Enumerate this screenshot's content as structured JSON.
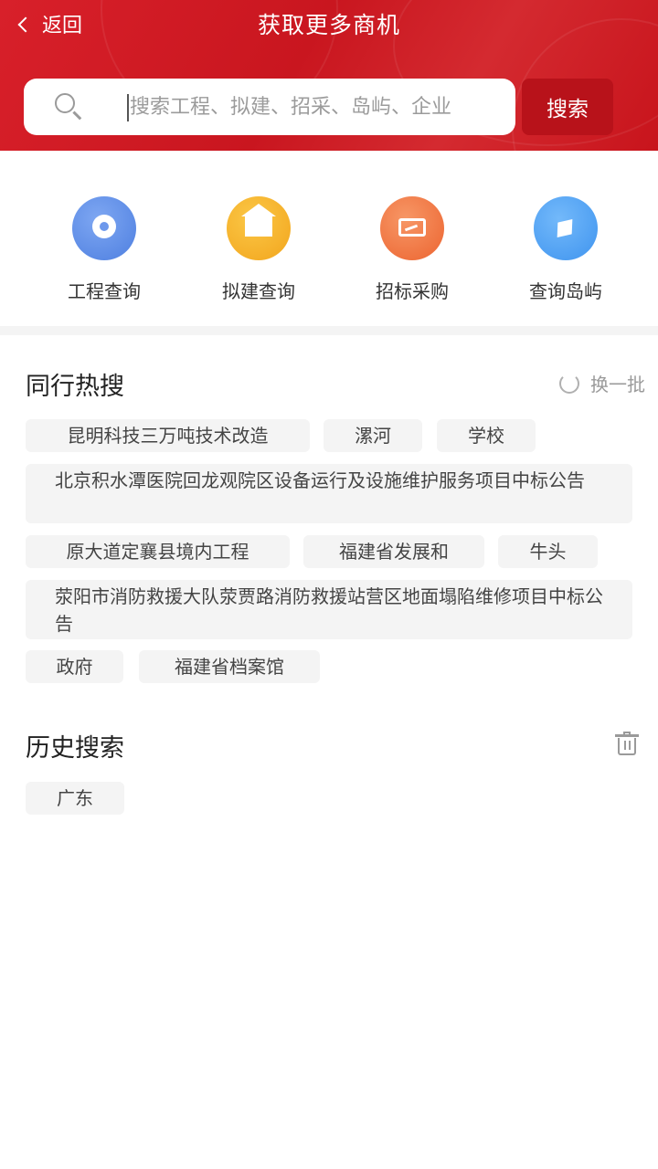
{
  "header": {
    "back_label": "返回",
    "title": "获取更多商机",
    "search_placeholder": "搜索工程、拟建、招采、岛屿、企业",
    "search_button": "搜索",
    "accent_color": "#d21d26"
  },
  "quick_links": [
    {
      "label": "工程查询",
      "icon": "camera-icon"
    },
    {
      "label": "拟建查询",
      "icon": "house-icon"
    },
    {
      "label": "招标采购",
      "icon": "chart-screen-icon"
    },
    {
      "label": "查询岛屿",
      "icon": "compass-icon"
    }
  ],
  "hot_search": {
    "title": "同行热搜",
    "refresh_label": "换一批",
    "tags": [
      "昆明科技三万吨技术改造",
      "漯河",
      "学校",
      "北京积水潭医院回龙观院区设备运行及设施维护服务项目中标公告",
      "原大道定襄县境内工程",
      "福建省发展和",
      "牛头",
      "荥阳市消防救援大队荥贾路消防救援站营区地面塌陷维修项目中标公告",
      "政府",
      "福建省档案馆"
    ]
  },
  "history": {
    "title": "历史搜索",
    "tags": [
      "广东"
    ]
  }
}
